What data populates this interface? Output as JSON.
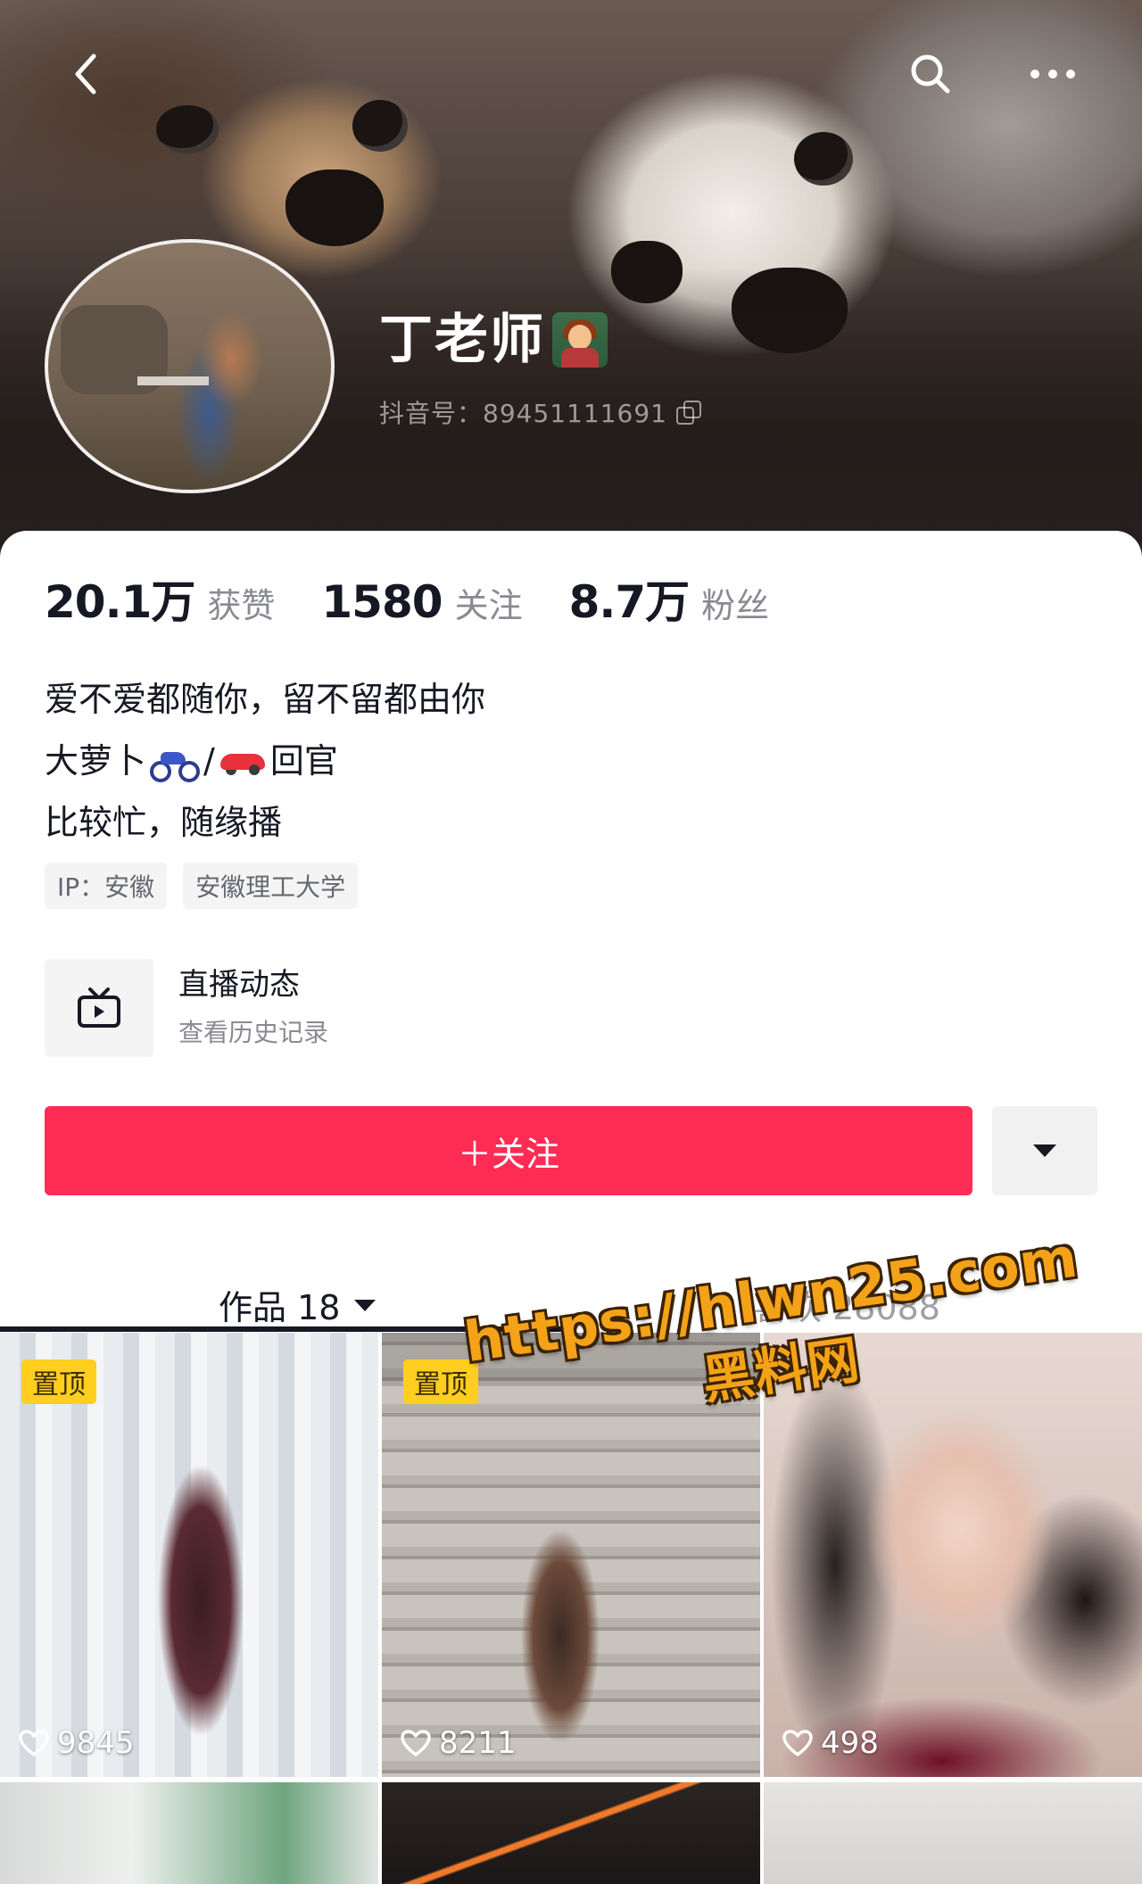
{
  "header": {
    "back_icon": "chevron-left-icon",
    "search_icon": "search-icon",
    "more_icon": "ellipsis-icon"
  },
  "profile": {
    "name": "丁老师",
    "name_badge_icon": "teacher-emoji-icon",
    "douyin_id": "抖音号：89451111691",
    "copy_icon": "copy-icon"
  },
  "stats": [
    {
      "value": "20.1万",
      "label": "获赞"
    },
    {
      "value": "1580",
      "label": "关注"
    },
    {
      "value": "8.7万",
      "label": "粉丝"
    }
  ],
  "bio": {
    "line1": "爱不爱都随你，留不留都由你",
    "line2_prefix": "大萝卜",
    "line2_sep": "/",
    "line2_suffix": "回官",
    "line3": "比较忙，随缘播"
  },
  "tags": [
    "IP：安徽",
    "安徽理工大学"
  ],
  "live": {
    "title": "直播动态",
    "subtitle": "查看历史记录",
    "icon": "tv-icon"
  },
  "actions": {
    "follow_label": "＋关注",
    "more_icon": "caret-down-icon",
    "accent_color": "#fe2c55"
  },
  "tabs": {
    "works": "作品 18",
    "likes": "喜欢 28088"
  },
  "videos": [
    {
      "pinned": true,
      "pin_label": "置顶",
      "likes": "9845"
    },
    {
      "pinned": true,
      "pin_label": "置顶",
      "likes": "8211"
    },
    {
      "pinned": false,
      "pin_label": "",
      "likes": "498"
    }
  ],
  "watermark": {
    "url": "https://hlwn25.com",
    "title": "黑料网"
  }
}
